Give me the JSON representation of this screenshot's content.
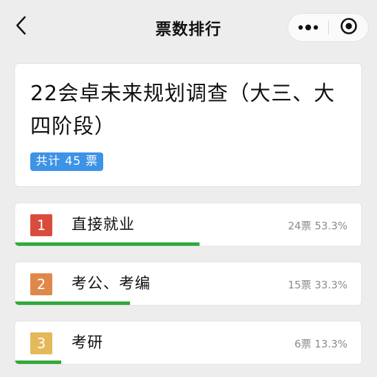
{
  "header": {
    "title": "票数排行",
    "back_icon": "chevron-left-icon",
    "more_icon": "more-dots-icon",
    "close_icon": "target-circle-icon"
  },
  "survey": {
    "title": "22会卓未来规划调查（大三、大四阶段）",
    "total_votes_label": "共计 45 票"
  },
  "colors": {
    "badge_blue": "#3d93e6",
    "progress_green": "#33a83c",
    "rank1": "#d94c3d",
    "rank2": "#e0884a",
    "rank3": "#e4b95a"
  },
  "ranking": [
    {
      "rank": "1",
      "label": "直接就业",
      "votes": "24票",
      "percent": "53.3%",
      "share": 0.533,
      "color": "#d94c3d"
    },
    {
      "rank": "2",
      "label": "考公、考编",
      "votes": "15票",
      "percent": "33.3%",
      "share": 0.333,
      "color": "#e0884a"
    },
    {
      "rank": "3",
      "label": "考研",
      "votes": "6票",
      "percent": "13.3%",
      "share": 0.133,
      "color": "#e4b95a"
    }
  ]
}
